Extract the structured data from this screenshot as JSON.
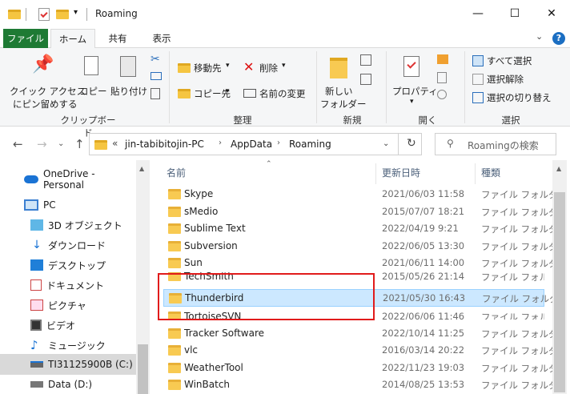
{
  "window": {
    "title": "Roaming",
    "minimize_glyph": "—",
    "maximize_glyph": "☐",
    "close_glyph": "✕"
  },
  "ribbon": {
    "tabs": [
      "ファイル",
      "ホーム",
      "共有",
      "表示"
    ],
    "clipboard": {
      "quick_access": "クイック アクセス",
      "pin": "にピン留めする",
      "copy": "コピー",
      "paste": "貼り付け",
      "group_label": "クリップボード"
    },
    "organize": {
      "move_to": "移動先",
      "copy_to": "コピー先",
      "delete": "削除",
      "rename": "名前の変更",
      "group_label": "整理"
    },
    "new": {
      "new_folder_line1": "新しい",
      "new_folder_line2": "フォルダー",
      "group_label": "新規"
    },
    "open": {
      "properties": "プロパティ",
      "group_label": "開く"
    },
    "select": {
      "select_all": "すべて選択",
      "select_none": "選択解除",
      "invert": "選択の切り替え",
      "group_label": "選択"
    }
  },
  "address": {
    "overflow": "«",
    "crumbs": [
      "jin-tabibitojin-PC",
      "AppData",
      "Roaming"
    ],
    "search_placeholder": "Roamingの検索"
  },
  "nav": {
    "items": [
      {
        "label": "OneDrive - Personal",
        "icon": "cloud-icon"
      },
      {
        "label": "PC",
        "icon": "pc-icon"
      },
      {
        "label": "3D オブジェクト",
        "icon": "3d-objects-icon"
      },
      {
        "label": "ダウンロード",
        "icon": "download-icon"
      },
      {
        "label": "デスクトップ",
        "icon": "desktop-icon"
      },
      {
        "label": "ドキュメント",
        "icon": "documents-icon"
      },
      {
        "label": "ピクチャ",
        "icon": "pictures-icon"
      },
      {
        "label": "ビデオ",
        "icon": "videos-icon"
      },
      {
        "label": "ミュージック",
        "icon": "music-icon"
      },
      {
        "label": "TI31125900B (C:)",
        "icon": "drive-icon"
      },
      {
        "label": "Data (D:)",
        "icon": "drive-icon"
      }
    ]
  },
  "list": {
    "columns": [
      "名前",
      "更新日時",
      "種類"
    ],
    "rows": [
      {
        "name": "Skype",
        "date": "2021/06/03 11:58",
        "type": "ファイル フォルダー"
      },
      {
        "name": "sMedio",
        "date": "2015/07/07 18:21",
        "type": "ファイル フォルダー"
      },
      {
        "name": "Sublime Text",
        "date": "2022/04/19 9:21",
        "type": "ファイル フォルダー"
      },
      {
        "name": "Subversion",
        "date": "2022/06/05 13:30",
        "type": "ファイル フォルダー"
      },
      {
        "name": "Sun",
        "date": "2021/06/11 14:00",
        "type": "ファイル フォルダー"
      },
      {
        "name": "TechSmith",
        "date": "2015/05/26 21:14",
        "type": "ファイル フォルダー"
      },
      {
        "name": "Thunderbird",
        "date": "2021/05/30 16:43",
        "type": "ファイル フォルダー"
      },
      {
        "name": "TortoiseSVN",
        "date": "2022/06/06 11:46",
        "type": "ファイル フォルダー"
      },
      {
        "name": "Tracker Software",
        "date": "2022/10/14 11:25",
        "type": "ファイル フォルダー"
      },
      {
        "name": "vlc",
        "date": "2016/03/14 20:22",
        "type": "ファイル フォルダー"
      },
      {
        "name": "WeatherTool",
        "date": "2022/11/23 19:03",
        "type": "ファイル フォルダー"
      },
      {
        "name": "WinBatch",
        "date": "2014/08/25 13:53",
        "type": "ファイル フォルダー"
      }
    ]
  }
}
